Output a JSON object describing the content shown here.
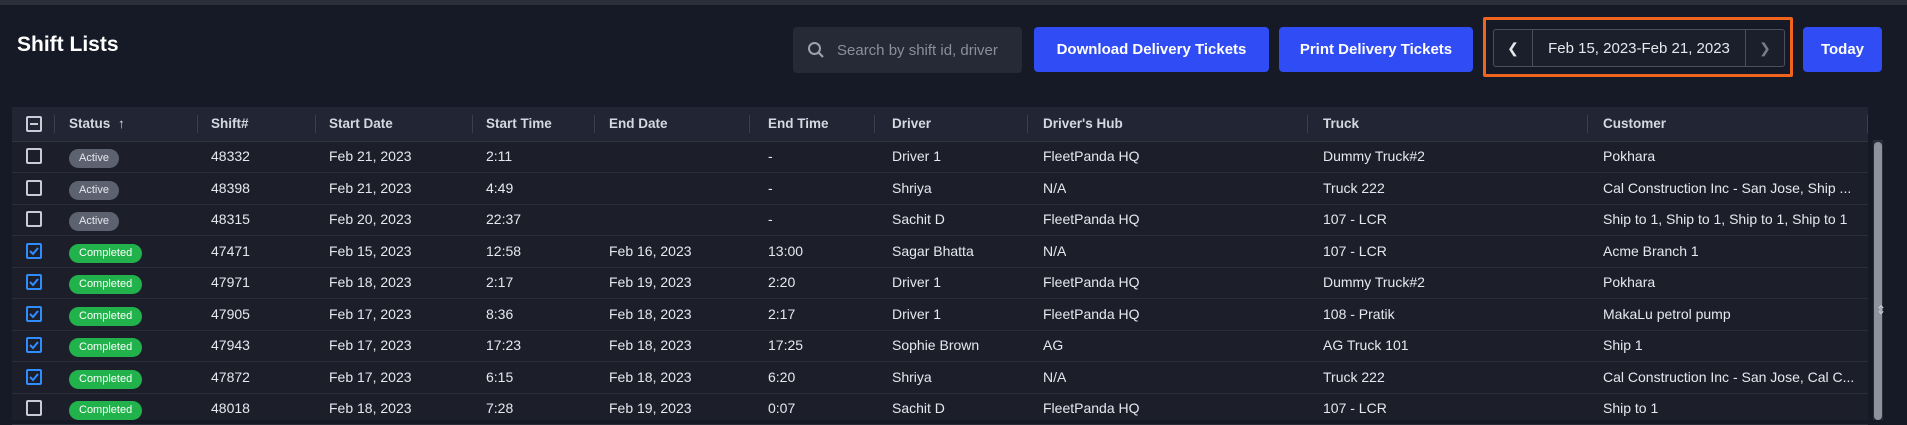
{
  "header": {
    "title": "Shift Lists",
    "search_placeholder": "Search by shift id, driver",
    "download_label": "Download Delivery Tickets",
    "print_label": "Print Delivery Tickets",
    "date_range": "Feb 15, 2023-Feb 21, 2023",
    "today_label": "Today"
  },
  "colors": {
    "accent": "#2f4cf5",
    "highlight": "#f0641e",
    "completed": "#21b24b",
    "active": "#5d6270"
  },
  "table": {
    "columns": [
      "Status",
      "Shift#",
      "Start Date",
      "Start Time",
      "End Date",
      "End Time",
      "Driver",
      "Driver's Hub",
      "Truck",
      "Customer"
    ],
    "sort_indicator": "↑",
    "rows": [
      {
        "checked": false,
        "status": "Active",
        "shift": "48332",
        "start_date": "Feb 21, 2023",
        "start_time": "2:11",
        "end_date": "",
        "end_time": "-",
        "driver": "Driver 1",
        "hub": "FleetPanda HQ",
        "truck": "Dummy Truck#2",
        "customer": "Pokhara"
      },
      {
        "checked": false,
        "status": "Active",
        "shift": "48398",
        "start_date": "Feb 21, 2023",
        "start_time": "4:49",
        "end_date": "",
        "end_time": "-",
        "driver": "Shriya",
        "hub": "N/A",
        "truck": "Truck 222",
        "customer": "Cal Construction Inc - San Jose, Ship ..."
      },
      {
        "checked": false,
        "status": "Active",
        "shift": "48315",
        "start_date": "Feb 20, 2023",
        "start_time": "22:37",
        "end_date": "",
        "end_time": "-",
        "driver": "Sachit D",
        "hub": "FleetPanda HQ",
        "truck": "107 - LCR",
        "customer": "Ship to 1, Ship to 1, Ship to 1, Ship to 1"
      },
      {
        "checked": true,
        "status": "Completed",
        "shift": "47471",
        "start_date": "Feb 15, 2023",
        "start_time": "12:58",
        "end_date": "Feb 16, 2023",
        "end_time": "13:00",
        "driver": "Sagar Bhatta",
        "hub": "N/A",
        "truck": "107 - LCR",
        "customer": "Acme Branch 1"
      },
      {
        "checked": true,
        "status": "Completed",
        "shift": "47971",
        "start_date": "Feb 18, 2023",
        "start_time": "2:17",
        "end_date": "Feb 19, 2023",
        "end_time": "2:20",
        "driver": "Driver 1",
        "hub": "FleetPanda HQ",
        "truck": "Dummy Truck#2",
        "customer": "Pokhara"
      },
      {
        "checked": true,
        "status": "Completed",
        "shift": "47905",
        "start_date": "Feb 17, 2023",
        "start_time": "8:36",
        "end_date": "Feb 18, 2023",
        "end_time": "2:17",
        "driver": "Driver 1",
        "hub": "FleetPanda HQ",
        "truck": "108 - Pratik",
        "customer": "MakaLu petrol pump"
      },
      {
        "checked": true,
        "status": "Completed",
        "shift": "47943",
        "start_date": "Feb 17, 2023",
        "start_time": "17:23",
        "end_date": "Feb 18, 2023",
        "end_time": "17:25",
        "driver": "Sophie Brown",
        "hub": "AG",
        "truck": "AG Truck 101",
        "customer": "Ship 1"
      },
      {
        "checked": true,
        "status": "Completed",
        "shift": "47872",
        "start_date": "Feb 17, 2023",
        "start_time": "6:15",
        "end_date": "Feb 18, 2023",
        "end_time": "6:20",
        "driver": "Shriya",
        "hub": "N/A",
        "truck": "Truck 222",
        "customer": "Cal Construction Inc - San Jose, Cal C..."
      },
      {
        "checked": false,
        "status": "Completed",
        "shift": "48018",
        "start_date": "Feb 18, 2023",
        "start_time": "7:28",
        "end_date": "Feb 19, 2023",
        "end_time": "0:07",
        "driver": "Sachit D",
        "hub": "FleetPanda HQ",
        "truck": "107 - LCR",
        "customer": "Ship to 1"
      }
    ]
  }
}
